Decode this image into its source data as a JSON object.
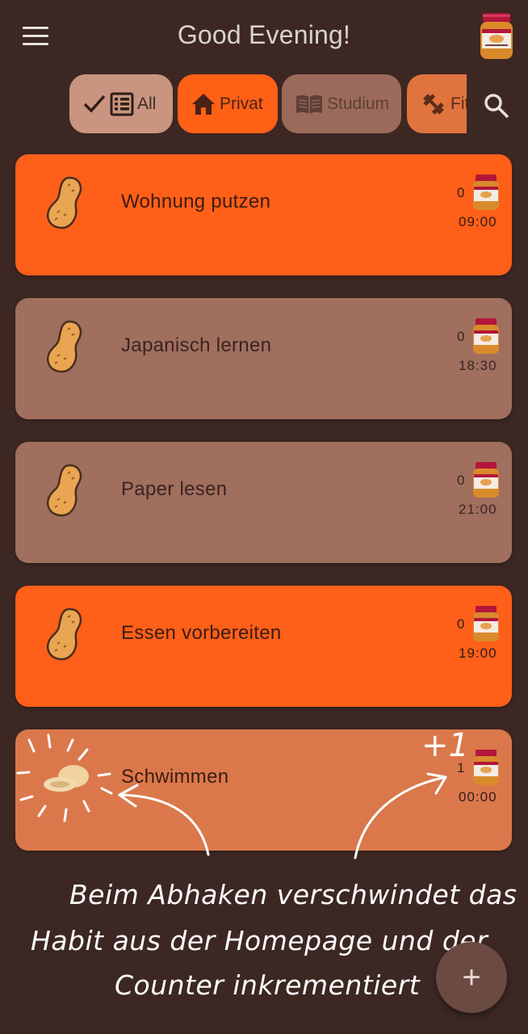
{
  "appbar": {
    "title": "Good Evening!",
    "menu_icon": "menu-icon",
    "avatar_icon": "peanut-butter-jar-icon"
  },
  "chips": [
    {
      "label": "All",
      "icon": "check-list-icon"
    },
    {
      "label": "Privat",
      "icon": "home-icon"
    },
    {
      "label": "Studium",
      "icon": "book-icon"
    },
    {
      "label": "Fit",
      "icon": "dumbbell-icon"
    }
  ],
  "search_icon": "search-icon",
  "habits": [
    {
      "name": "Wohnung putzen",
      "count": "0",
      "time": "09:00",
      "color": "#fe5f19"
    },
    {
      "name": "Japanisch lernen",
      "count": "0",
      "time": "18:30",
      "color": "#a06f5e"
    },
    {
      "name": "Paper lesen",
      "count": "0",
      "time": "21:00",
      "color": "#a06f5e"
    },
    {
      "name": "Essen vorbereiten",
      "count": "0",
      "time": "19:00",
      "color": "#fe5f19"
    },
    {
      "name": "Schwimmen",
      "count": "1",
      "time": "00:00",
      "color": "#db784b"
    }
  ],
  "annotation": {
    "plus_one": "+1",
    "lines": [
      "Beim Abhaken verschwindet das",
      "Habit aus der Homepage und der",
      "Counter inkrementiert"
    ]
  },
  "fab": {
    "label": "+",
    "icon": "add-icon"
  }
}
